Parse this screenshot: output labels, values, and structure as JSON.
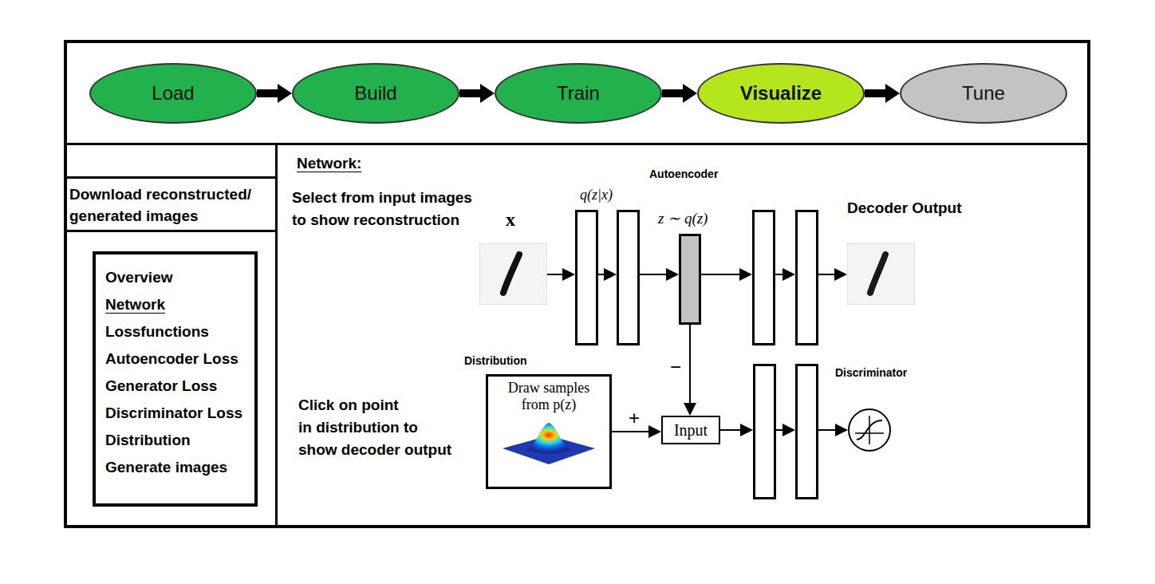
{
  "pipeline": [
    {
      "label": "Load",
      "selected": false,
      "color": "#22b14c"
    },
    {
      "label": "Build",
      "selected": false,
      "color": "#22b14c"
    },
    {
      "label": "Train",
      "selected": false,
      "color": "#22b14c"
    },
    {
      "label": "Visualize",
      "selected": true,
      "color": "#b5e61d"
    },
    {
      "label": "Tune",
      "selected": false,
      "color": "#c3c3c3"
    }
  ],
  "sidebar": {
    "download": [
      "Download reconstructed/",
      "generated images"
    ],
    "items": [
      {
        "label": "Overview",
        "selected": false
      },
      {
        "label": "Network",
        "selected": true
      },
      {
        "label": "Lossfunctions",
        "selected": false
      },
      {
        "label": "Autoencoder Loss",
        "selected": false
      },
      {
        "label": "Generator Loss",
        "selected": false
      },
      {
        "label": "Discriminator Loss",
        "selected": false
      },
      {
        "label": "Distribution",
        "selected": false
      },
      {
        "label": "Generate images",
        "selected": false
      }
    ]
  },
  "network": {
    "heading": "Network:",
    "select_hint": [
      "Select from input images",
      "to show reconstruction"
    ],
    "click_hint": [
      "Click on point",
      "in distribution to",
      "show decoder output"
    ],
    "autoencoder_title": "Autoencoder",
    "encoder_label": "q(z|x)",
    "input_label": "x",
    "latent_label": "z ∼ q(z)",
    "decoder_output": "Decoder Output",
    "distribution_title": "Distribution",
    "distribution_text": [
      "Draw samples",
      "from p(z)"
    ],
    "plus_sign": "+",
    "minus_sign": "−",
    "input_node": "Input",
    "discriminator_title": "Discriminator"
  }
}
